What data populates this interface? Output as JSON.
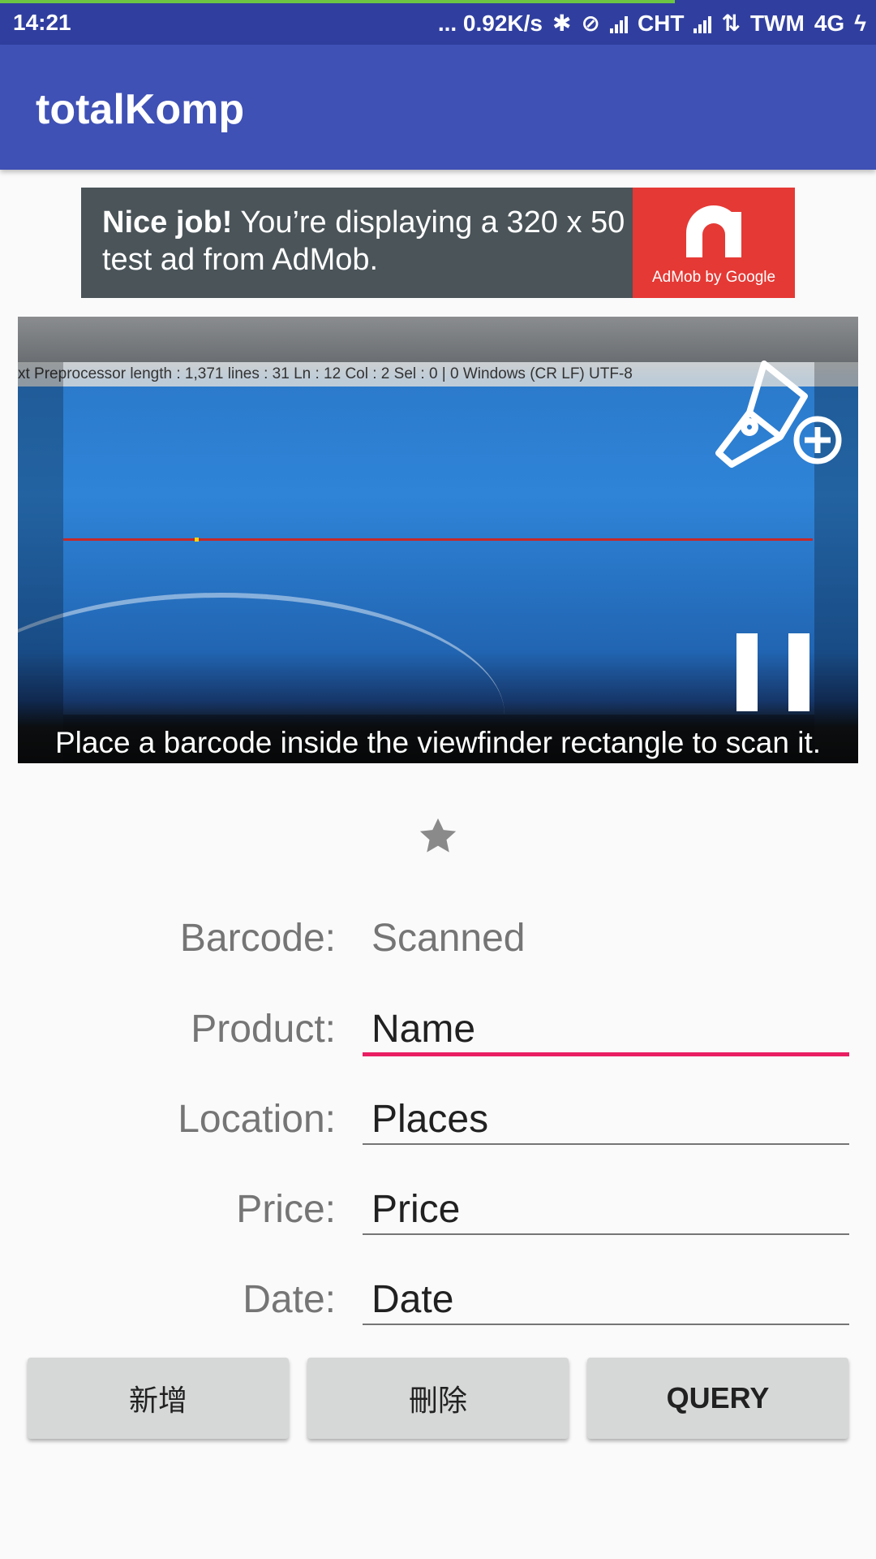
{
  "status_bar": {
    "time": "14:21",
    "net_speed": "... 0.92K/s",
    "carrier1": "CHT",
    "carrier2": "TWM",
    "network": "4G",
    "download_progress_pct": 77
  },
  "app_bar": {
    "title": "totalKomp"
  },
  "ad": {
    "headline": "Nice job!",
    "text": " You’re displaying a 320 x 50 test ad from AdMob.",
    "brand": "AdMob by Google"
  },
  "scanner": {
    "background_text": "xt Preprocessor   length : 1,371    lines : 31        Ln : 12    Col : 2    Sel : 0 | 0                       Windows (CR LF)   UTF-8",
    "hint": "Place a barcode inside the viewfinder rectangle to scan it.",
    "icons": [
      "flashlight-add-icon",
      "pause-icon"
    ]
  },
  "form": {
    "barcode": {
      "label": "Barcode:",
      "value": "Scanned"
    },
    "product": {
      "label": "Product:",
      "value": "Name"
    },
    "location": {
      "label": "Location:",
      "value": "Places"
    },
    "price": {
      "label": "Price:",
      "value": "Price"
    },
    "date": {
      "label": "Date:",
      "value": "Date"
    }
  },
  "buttons": {
    "add": "新增",
    "delete": "刪除",
    "query": "QUERY"
  },
  "colors": {
    "status_bar": "#303f9f",
    "app_bar": "#3f51b5",
    "accent": "#e91e63",
    "ad_bg": "#4a5459",
    "ad_logo": "#e53935"
  }
}
